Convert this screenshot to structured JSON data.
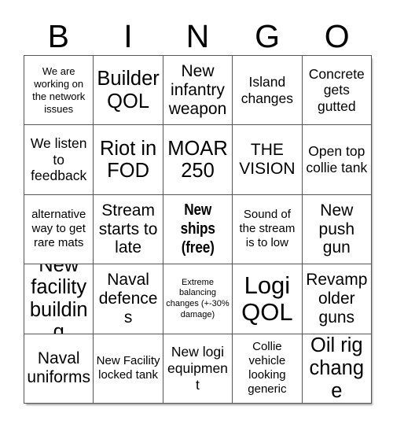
{
  "header": {
    "letters": [
      "B",
      "I",
      "N",
      "G",
      "O"
    ]
  },
  "grid": {
    "rows": 5,
    "columns": 5,
    "border_color": "#555555",
    "background_color": "#ffffff",
    "text_color": "#000000",
    "cells": [
      {
        "text": "We are working on the network issues",
        "size": "fs-xs",
        "bold": false
      },
      {
        "text": "Builder QOL",
        "size": "fs-xl",
        "bold": false
      },
      {
        "text": "New infantry weapon",
        "size": "fs-l",
        "bold": false
      },
      {
        "text": "Island changes",
        "size": "fs-m",
        "bold": false
      },
      {
        "text": "Concrete gets gutted",
        "size": "fs-m",
        "bold": false
      },
      {
        "text": "We listen to feedback",
        "size": "fs-m",
        "bold": false
      },
      {
        "text": "Riot in FOD",
        "size": "fs-xl",
        "bold": false
      },
      {
        "text": "MOAR 250",
        "size": "fs-xl",
        "bold": false
      },
      {
        "text": "THE VISION",
        "size": "fs-l",
        "bold": false
      },
      {
        "text": "Open top collie tank",
        "size": "fs-m",
        "bold": false
      },
      {
        "text": "alternative way to get rare mats",
        "size": "fs-s",
        "bold": false
      },
      {
        "text": "Stream starts to late",
        "size": "fs-l",
        "bold": false
      },
      {
        "text": "New ships (free)",
        "size": "bold-condensed",
        "bold": true
      },
      {
        "text": "Sound of the stream is to low",
        "size": "fs-s",
        "bold": false
      },
      {
        "text": "New push gun",
        "size": "fs-l",
        "bold": false
      },
      {
        "text": "New facility building",
        "size": "fs-xl",
        "bold": false
      },
      {
        "text": "Naval defences",
        "size": "fs-l",
        "bold": false
      },
      {
        "text": "Extreme balancing changes (+-30% damage)",
        "size": "fs-xxs",
        "bold": false
      },
      {
        "text": "Logi QOL",
        "size": "fs-xxl",
        "bold": false
      },
      {
        "text": "Revamp older guns",
        "size": "fs-l",
        "bold": false
      },
      {
        "text": "Naval uniforms",
        "size": "fs-l",
        "bold": false
      },
      {
        "text": "New Facility locked tank",
        "size": "fs-s",
        "bold": false
      },
      {
        "text": "New logi equipment",
        "size": "fs-m",
        "bold": false
      },
      {
        "text": "Collie vehicle looking generic",
        "size": "fs-s",
        "bold": false
      },
      {
        "text": "Oil rig change",
        "size": "fs-xl",
        "bold": false
      }
    ]
  }
}
